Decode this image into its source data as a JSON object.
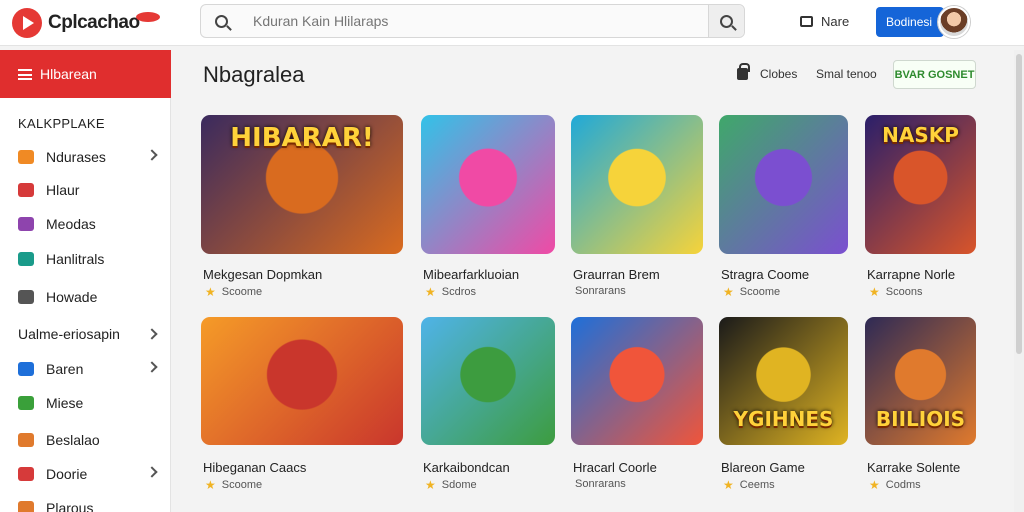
{
  "header": {
    "logo_text": "Cplcachao",
    "search_placeholder": "Kduran Kain Hlilaraps",
    "notice_label": "Nare",
    "signin_label": "Bodinesi"
  },
  "sidebar": {
    "active_label": "Hlbarean",
    "heading": "KALKPPLAKE",
    "items": [
      {
        "label": "Ndurases",
        "icon": "video-icon",
        "color": "#f08a24",
        "chevron": true
      },
      {
        "label": "Hlaur",
        "icon": "bookmark-icon",
        "color": "#d63a3a",
        "chevron": false
      },
      {
        "label": "Meodas",
        "icon": "shield-icon",
        "color": "#8e44ad",
        "chevron": false
      },
      {
        "label": "Hanlitrals",
        "icon": "chat-icon",
        "color": "#1a9b8a",
        "chevron": false
      },
      {
        "label": "Howade",
        "icon": "document-icon",
        "color": "#555555",
        "chevron": false
      }
    ],
    "subheading": "Ualme-eriosapin",
    "sub_items": [
      {
        "label": "Baren",
        "icon": "check-icon",
        "color": "#1e6fd9",
        "chevron": true
      },
      {
        "label": "Miese",
        "icon": "gamepad-icon",
        "color": "#3aa03a",
        "chevron": false
      },
      {
        "label": "Beslalao",
        "icon": "folder-icon",
        "color": "#e07a2d",
        "chevron": false
      },
      {
        "label": "Doorie",
        "icon": "calendar-icon",
        "color": "#d63a3a",
        "chevron": true
      },
      {
        "label": "Plarous",
        "icon": "star-icon",
        "color": "#e07a2d",
        "chevron": false
      }
    ]
  },
  "main": {
    "title": "Nbagralea",
    "filter_label": "Clobes",
    "sort_label": "Smal tenoo",
    "action_label": "BVAR GOSNET"
  },
  "games": [
    {
      "title": "Mekgesan Dopmkan",
      "meta": "Scoome",
      "star": true,
      "thumb_text": "HIBARAR!",
      "colors": [
        "#3a2a5e",
        "#d96b1f"
      ]
    },
    {
      "title": "Mibearfarkluoian",
      "meta": "Scdros",
      "star": true,
      "thumb_text": "",
      "colors": [
        "#32c2e8",
        "#f04aa5"
      ]
    },
    {
      "title": "Graurran Brem",
      "meta": "Sonrarans",
      "star": false,
      "thumb_text": "",
      "colors": [
        "#20a9d8",
        "#f6d33a"
      ]
    },
    {
      "title": "Stragra Coome",
      "meta": "Scoome",
      "star": true,
      "thumb_text": "",
      "colors": [
        "#3fa86a",
        "#7b4fd0"
      ]
    },
    {
      "title": "Karrapne Norle",
      "meta": "Scoons",
      "star": true,
      "thumb_text": "NASKP",
      "colors": [
        "#2a1f6a",
        "#d9552a"
      ]
    },
    {
      "title": "Hibeganan Caacs",
      "meta": "Scoome",
      "star": true,
      "thumb_text": "",
      "colors": [
        "#f59b28",
        "#c9362c"
      ]
    },
    {
      "title": "Karkaibondcan",
      "meta": "Sdome",
      "star": true,
      "thumb_text": "",
      "colors": [
        "#4fb3e8",
        "#3d9c3f"
      ]
    },
    {
      "title": "Hracarl Coorle",
      "meta": "Sonrarans",
      "star": false,
      "thumb_text": "",
      "colors": [
        "#1e6fd9",
        "#f0553a"
      ]
    },
    {
      "title": "Blareon Game",
      "meta": "Ceems",
      "star": true,
      "thumb_text": "YGIHNES",
      "colors": [
        "#1a1a1a",
        "#e0b422"
      ]
    },
    {
      "title": "Karrake Solente",
      "meta": "Codms",
      "star": true,
      "thumb_text": "BIILIOIS",
      "colors": [
        "#2e2a55",
        "#e07a2d"
      ]
    }
  ]
}
